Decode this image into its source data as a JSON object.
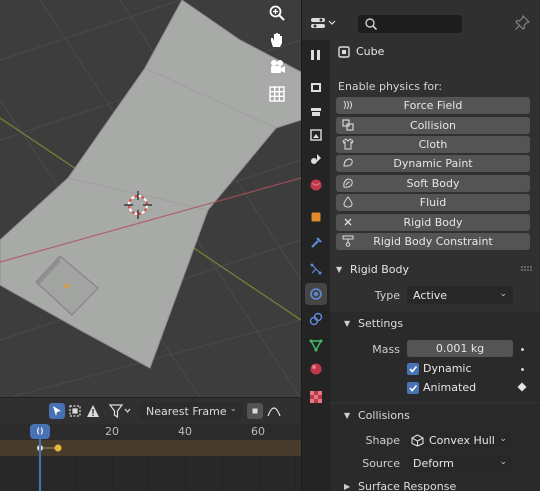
{
  "properties": {
    "object_name": "Cube",
    "enable_physics_label": "Enable physics for:",
    "physics_buttons": [
      {
        "label": "Force Field",
        "icon": "force-field-icon"
      },
      {
        "label": "Collision",
        "icon": "collision-icon"
      },
      {
        "label": "Cloth",
        "icon": "cloth-icon"
      },
      {
        "label": "Dynamic Paint",
        "icon": "dynamic-paint-icon"
      },
      {
        "label": "Soft Body",
        "icon": "soft-body-icon"
      },
      {
        "label": "Fluid",
        "icon": "fluid-icon"
      },
      {
        "label": "Rigid Body",
        "icon": "rigid-body-close-icon"
      },
      {
        "label": "Rigid Body Constraint",
        "icon": "rigid-body-constraint-icon"
      }
    ],
    "rigid_body": {
      "title": "Rigid Body",
      "type_label": "Type",
      "type_value": "Active",
      "settings": {
        "title": "Settings",
        "mass_label": "Mass",
        "mass_value": "0.001 kg",
        "dynamic_label": "Dynamic",
        "dynamic_checked": true,
        "animated_label": "Animated",
        "animated_checked": true
      },
      "collisions": {
        "title": "Collisions",
        "shape_label": "Shape",
        "shape_value": "Convex Hull",
        "source_label": "Source",
        "source_value": "Deform"
      },
      "surface_response_title": "Surface Response"
    }
  },
  "timeline": {
    "snap_mode": "Nearest Frame",
    "current_frame": "0",
    "ticks": [
      "20",
      "40",
      "60"
    ]
  },
  "colors": {
    "accent": "#4772b3",
    "viewport_bg": "#3d3d3d",
    "plane": "#a8aaa8",
    "x_axis": "#a8434c",
    "y_axis": "#7a9a34",
    "keyframe": "#e8b83a"
  }
}
